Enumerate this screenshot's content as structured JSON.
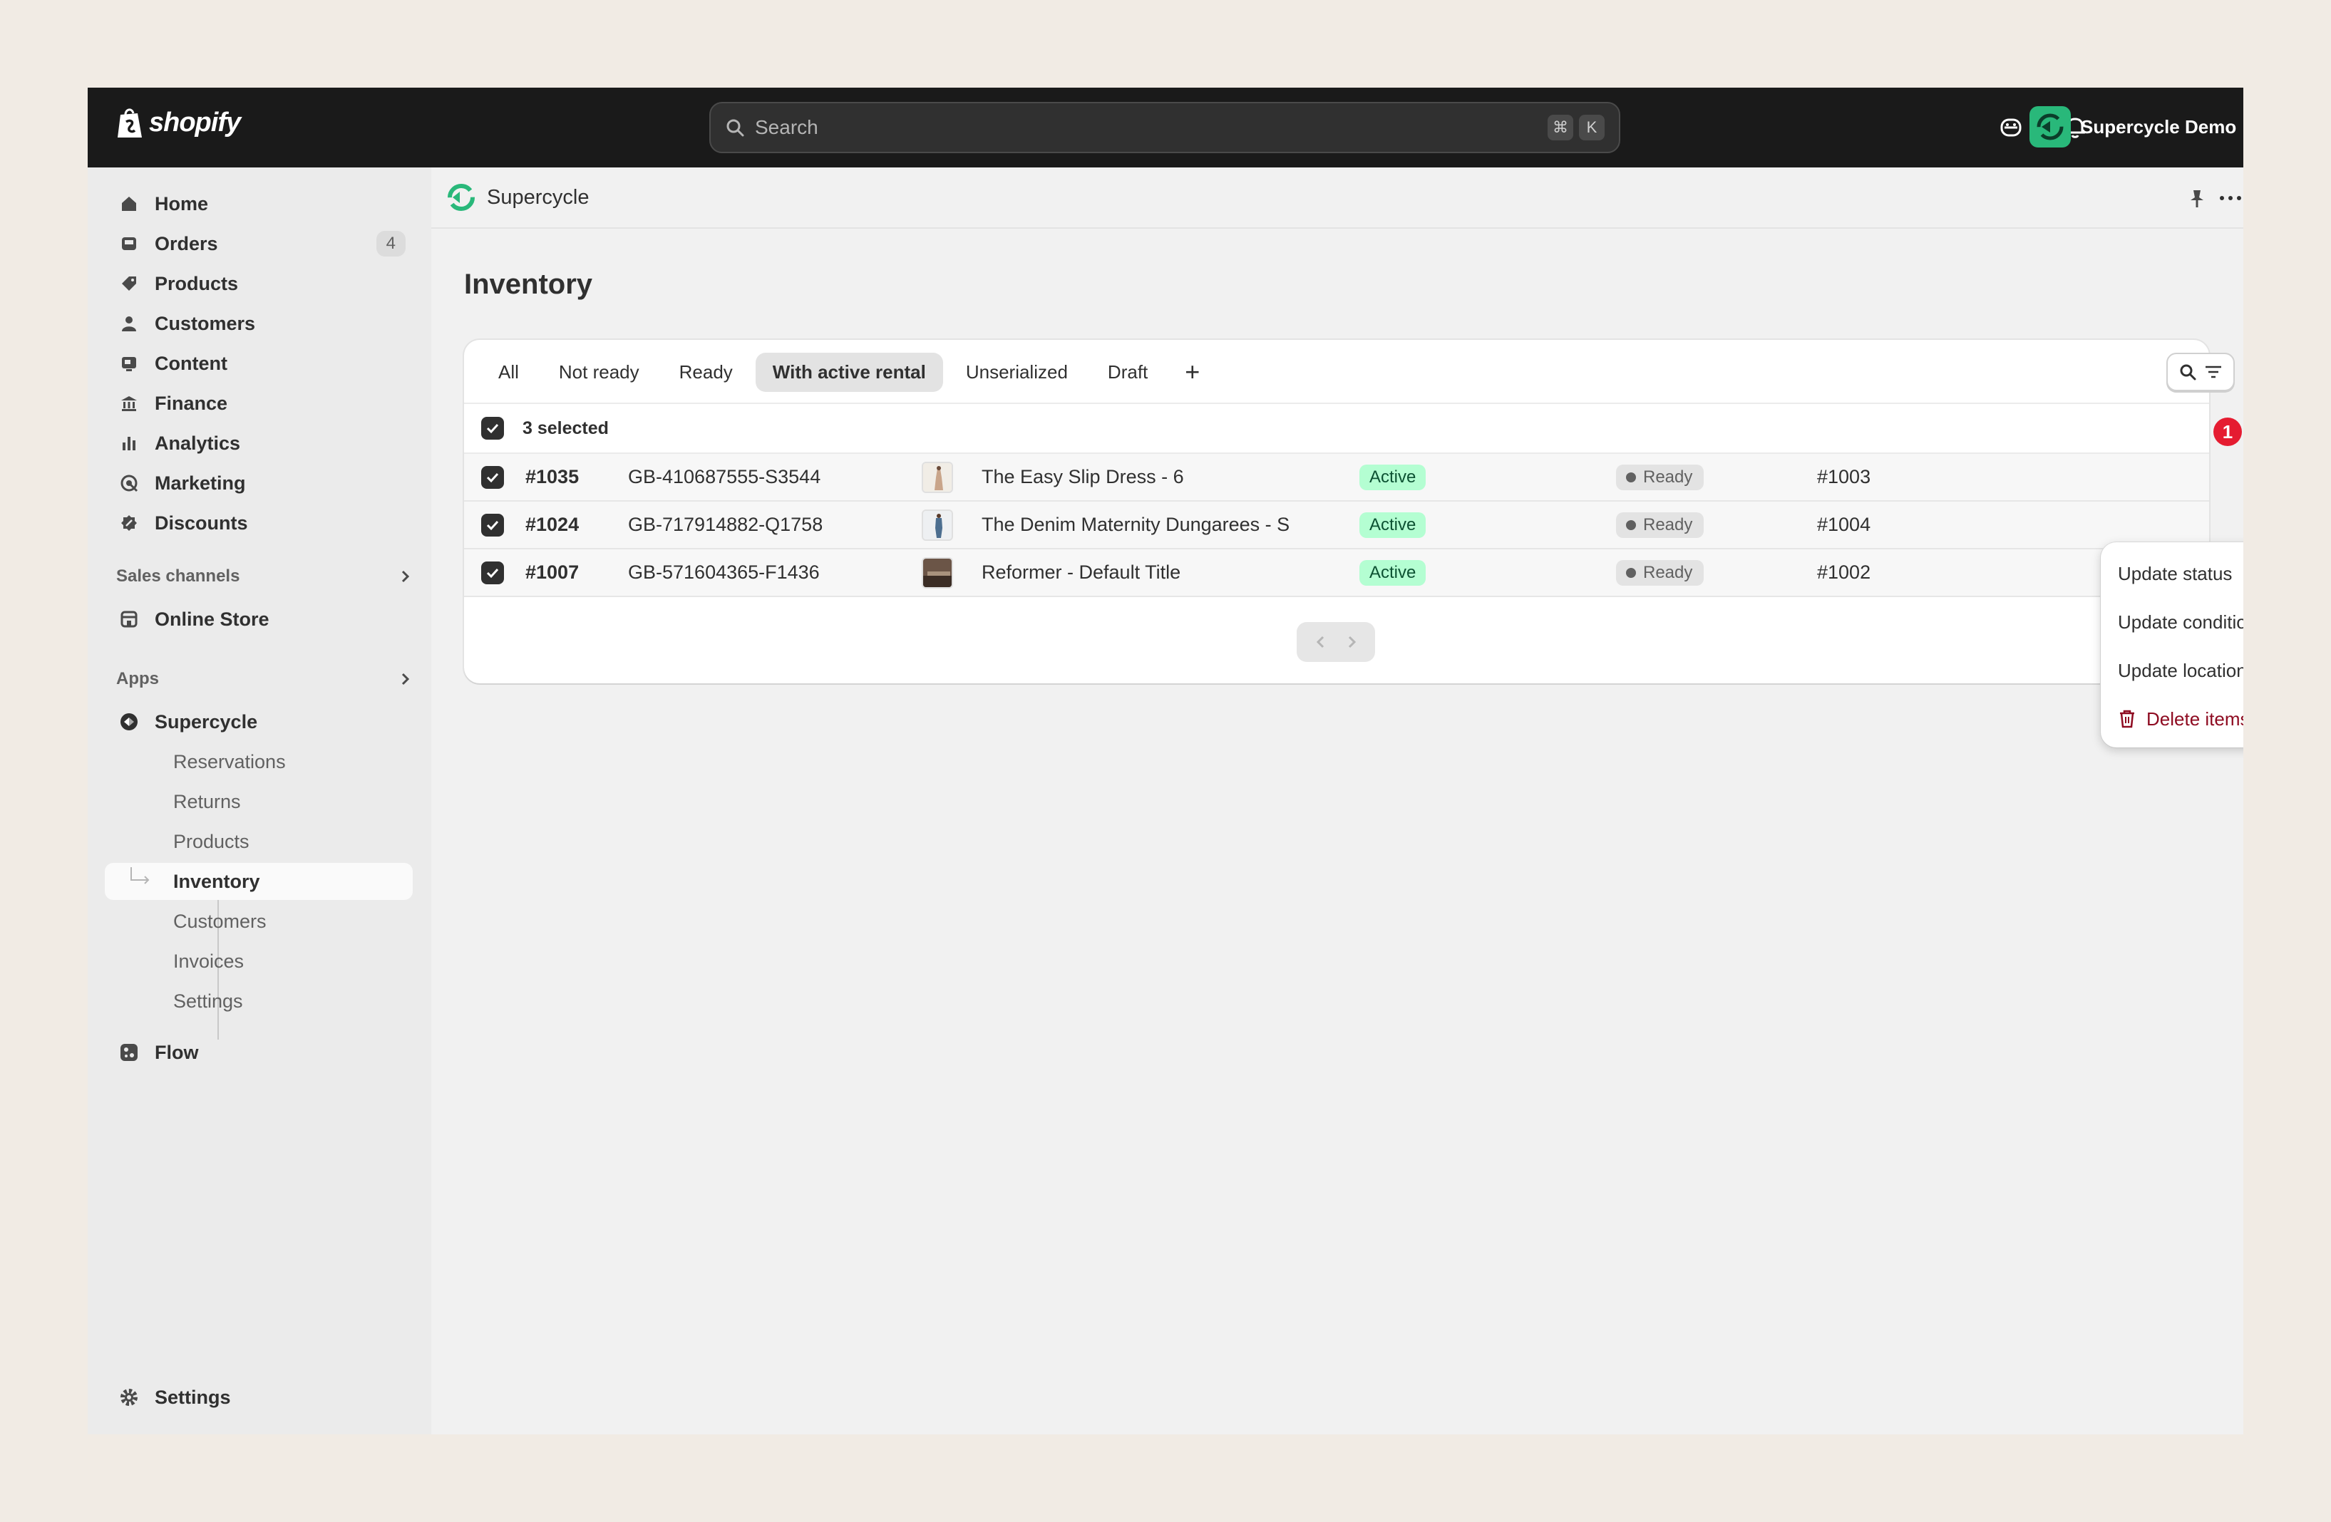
{
  "topbar": {
    "logo_text": "shopify",
    "search_placeholder": "Search",
    "shortcut_keys": [
      "⌘",
      "K"
    ],
    "store_name": "Supercycle Demo"
  },
  "sidebar": {
    "main_items": [
      {
        "label": "Home",
        "icon": "home-icon"
      },
      {
        "label": "Orders",
        "icon": "orders-icon",
        "badge": "4"
      },
      {
        "label": "Products",
        "icon": "tag-icon"
      },
      {
        "label": "Customers",
        "icon": "person-icon"
      },
      {
        "label": "Content",
        "icon": "content-icon"
      },
      {
        "label": "Finance",
        "icon": "bank-icon"
      },
      {
        "label": "Analytics",
        "icon": "bar-chart-icon"
      },
      {
        "label": "Marketing",
        "icon": "target-icon"
      },
      {
        "label": "Discounts",
        "icon": "discount-icon"
      }
    ],
    "sales_channels_label": "Sales channels",
    "online_store_label": "Online Store",
    "apps_label": "Apps",
    "app_name": "Supercycle",
    "app_subitems": [
      "Reservations",
      "Returns",
      "Products",
      "Inventory",
      "Customers",
      "Invoices",
      "Settings"
    ],
    "active_subitem": "Inventory",
    "flow_label": "Flow",
    "settings_label": "Settings"
  },
  "app_header": {
    "title": "Supercycle"
  },
  "page": {
    "title": "Inventory"
  },
  "tabs": [
    "All",
    "Not ready",
    "Ready",
    "With active rental",
    "Unserialized",
    "Draft"
  ],
  "selected_tab": "With active rental",
  "bulk": {
    "selected_text": "3 selected",
    "alert_count": "1"
  },
  "rows": [
    {
      "id": "#1035",
      "sku": "GB-410687555-S3544",
      "name": "The Easy Slip Dress - 6",
      "status": "Active",
      "condition": "Ready",
      "order": "#1003"
    },
    {
      "id": "#1024",
      "sku": "GB-717914882-Q1758",
      "name": "The Denim Maternity Dungarees - S",
      "status": "Active",
      "condition": "Ready",
      "order": "#1004"
    },
    {
      "id": "#1007",
      "sku": "GB-571604365-F1436",
      "name": "Reformer - Default Title",
      "status": "Active",
      "condition": "Ready",
      "order": "#1002"
    }
  ],
  "menu": {
    "items": [
      "Update status",
      "Update condition",
      "Update location"
    ],
    "danger_item": "Delete items"
  },
  "colors": {
    "topbar": "#1a1a1a",
    "brand_green": "#29b87a",
    "active_badge_bg": "#b4fed2",
    "alert_red": "#e51c31",
    "danger_text": "#8e0b21"
  }
}
